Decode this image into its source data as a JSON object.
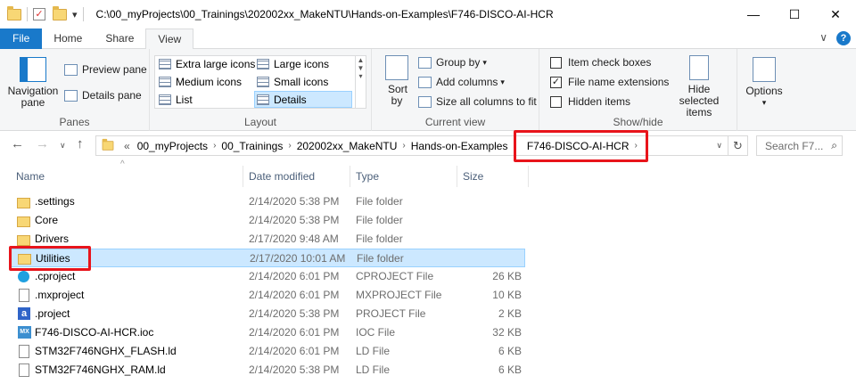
{
  "window": {
    "title": "C:\\00_myProjects\\00_Trainings\\202002xx_MakeNTU\\Hands-on-Examples\\F746-DISCO-AI-HCR",
    "minimize_glyph": "—",
    "maximize_glyph": "☐",
    "close_glyph": "✕",
    "qa_dropdown": "▾"
  },
  "tabs": [
    "File",
    "Home",
    "Share",
    "View"
  ],
  "tabs_right": {
    "chevron": "∨",
    "help": "?"
  },
  "ribbon": {
    "panes": {
      "label": "Panes",
      "navigation_pane": "Navigation pane",
      "preview_pane": "Preview pane",
      "details_pane": "Details pane"
    },
    "layout": {
      "label": "Layout",
      "extra_large": "Extra large icons",
      "large": "Large icons",
      "medium": "Medium icons",
      "small": "Small icons",
      "list": "List",
      "details": "Details"
    },
    "current_view": {
      "label": "Current view",
      "sort_by": "Sort by",
      "group_by": "Group by",
      "add_columns": "Add columns",
      "size_all": "Size all columns to fit"
    },
    "show_hide": {
      "label": "Show/hide",
      "item_checkboxes": "Item check boxes",
      "file_name_extensions": "File name extensions",
      "hidden_items": "Hidden items",
      "hide_selected": "Hide selected items",
      "item_checkboxes_checked": false,
      "file_name_extensions_checked": true,
      "hidden_items_checked": false
    },
    "options": "Options"
  },
  "address": {
    "overflow": "«",
    "segments": [
      "00_myProjects",
      "00_Trainings",
      "202002xx_MakeNTU",
      "Hands-on-Examples",
      "F746-DISCO-AI-HCR"
    ],
    "search_placeholder": "Search F7..."
  },
  "columns": {
    "name": "Name",
    "date": "Date modified",
    "type": "Type",
    "size": "Size"
  },
  "files": [
    {
      "name": ".settings",
      "date": "2/14/2020 5:38 PM",
      "type": "File folder",
      "size": "",
      "icon": "folder-icon"
    },
    {
      "name": "Core",
      "date": "2/14/2020 5:38 PM",
      "type": "File folder",
      "size": "",
      "icon": "folder-icon"
    },
    {
      "name": "Drivers",
      "date": "2/17/2020 9:48 AM",
      "type": "File folder",
      "size": "",
      "icon": "folder-icon"
    },
    {
      "name": "Utilities",
      "date": "2/17/2020 10:01 AM",
      "type": "File folder",
      "size": "",
      "icon": "folder-icon"
    },
    {
      "name": ".cproject",
      "date": "2/14/2020 6:01 PM",
      "type": "CPROJECT File",
      "size": "26 KB",
      "icon": "cproject-icon"
    },
    {
      "name": ".mxproject",
      "date": "2/14/2020 6:01 PM",
      "type": "MXPROJECT File",
      "size": "10 KB",
      "icon": "document-icon"
    },
    {
      "name": ".project",
      "date": "2/14/2020 5:38 PM",
      "type": "PROJECT File",
      "size": "2 KB",
      "icon": "project-icon"
    },
    {
      "name": "F746-DISCO-AI-HCR.ioc",
      "date": "2/14/2020 6:01 PM",
      "type": "IOC File",
      "size": "32 KB",
      "icon": "mx-icon"
    },
    {
      "name": "STM32F746NGHX_FLASH.ld",
      "date": "2/14/2020 6:01 PM",
      "type": "LD File",
      "size": "6 KB",
      "icon": "document-icon"
    },
    {
      "name": "STM32F746NGHX_RAM.ld",
      "date": "2/14/2020 5:38 PM",
      "type": "LD File",
      "size": "6 KB",
      "icon": "document-icon"
    }
  ],
  "colors": {
    "accent": "#1979ca",
    "selection": "#cce8ff",
    "highlight": "#e8141b"
  }
}
